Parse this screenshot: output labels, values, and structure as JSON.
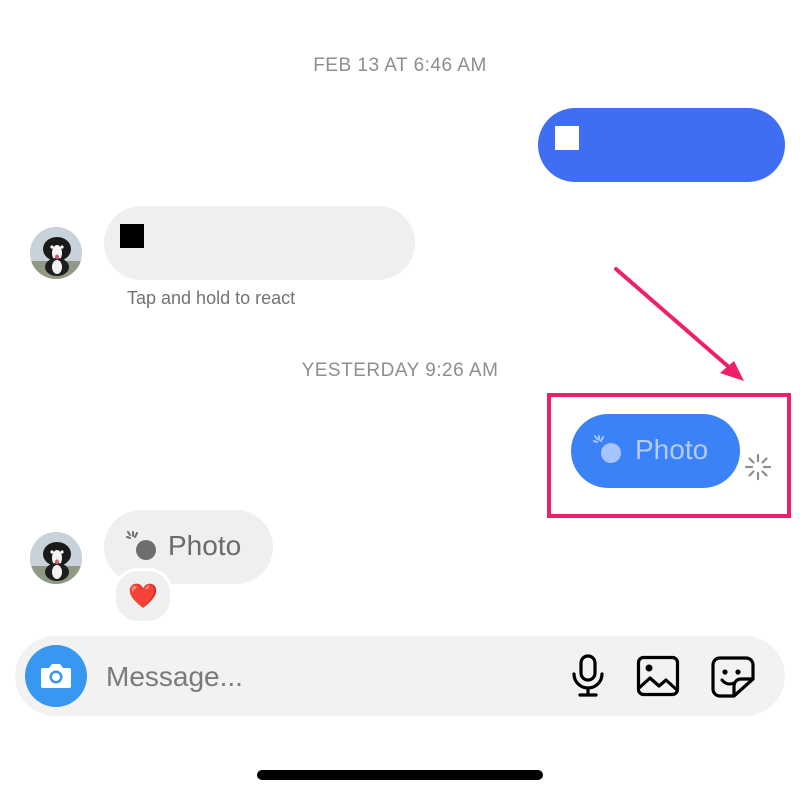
{
  "conversation": {
    "timestamps": [
      "FEB 13 AT 6:46 AM",
      "YESTERDAY 9:26 AM"
    ],
    "react_hint": "Tap and hold to react",
    "photo_out_label": "Photo",
    "photo_in_label": "Photo",
    "reaction_emoji": "❤️"
  },
  "composer": {
    "placeholder": "Message...",
    "icons": [
      "camera-icon",
      "microphone-icon",
      "gallery-icon",
      "sticker-icon"
    ]
  },
  "colors": {
    "outgoing_bubble": "#3f6ef3",
    "outgoing_photo_bubble": "#3b82f6",
    "incoming_bubble": "#efefef",
    "highlight": "#ee1f6c",
    "camera_button": "#3897f0"
  }
}
